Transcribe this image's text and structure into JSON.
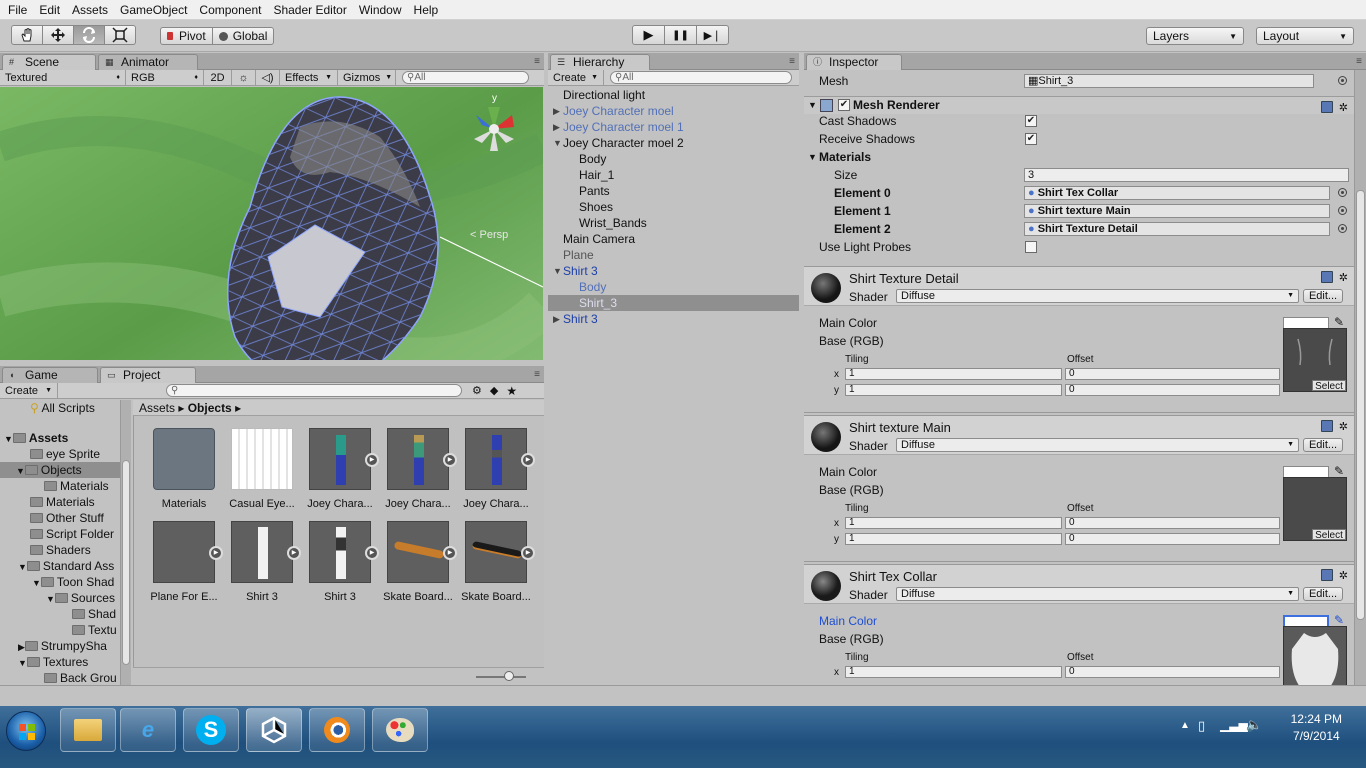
{
  "menu": [
    "File",
    "Edit",
    "Assets",
    "GameObject",
    "Component",
    "Shader Editor",
    "Window",
    "Help"
  ],
  "toolbar": {
    "pivot": "Pivot",
    "global": "Global",
    "layers": "Layers",
    "layout": "Layout",
    "play_icon": "▶",
    "pause_icon": "❚❚",
    "step_icon": "▶❘"
  },
  "scene": {
    "tab_scene": "Scene",
    "tab_animator": "Animator",
    "render_mode": "Textured",
    "color_mode": "RGB",
    "mode_2d": "2D",
    "effects": "Effects",
    "gizmos": "Gizmos",
    "search_placeholder": "All",
    "persp": "Persp",
    "gizmo_y": "y"
  },
  "hierarchy": {
    "tab": "Hierarchy",
    "create": "Create",
    "search_placeholder": "All",
    "items": [
      {
        "label": "Directional light"
      },
      {
        "label": "Joey Character moel"
      },
      {
        "label": "Joey Character moel 1"
      },
      {
        "label": "Joey Character moel 2"
      },
      {
        "label": "Body"
      },
      {
        "label": "Hair_1"
      },
      {
        "label": "Pants"
      },
      {
        "label": "Shoes"
      },
      {
        "label": "Wrist_Bands"
      },
      {
        "label": "Main Camera"
      },
      {
        "label": "Plane"
      },
      {
        "label": "Shirt 3"
      },
      {
        "label": "Body"
      },
      {
        "label": "Shirt_3"
      },
      {
        "label": "Shirt 3"
      }
    ]
  },
  "project": {
    "tab_game": "Game",
    "tab_project": "Project",
    "create": "Create",
    "crumb_root": "Assets",
    "crumb_current": "Objects",
    "tree": [
      {
        "label": "All Scripts"
      },
      {
        "label": "Assets"
      },
      {
        "label": "eye Sprite"
      },
      {
        "label": "Objects"
      },
      {
        "label": "Materials"
      },
      {
        "label": "Materials"
      },
      {
        "label": "Other Stuff"
      },
      {
        "label": "Script Folder"
      },
      {
        "label": "Shaders"
      },
      {
        "label": "Standard Ass"
      },
      {
        "label": "Toon Shad"
      },
      {
        "label": "Sources"
      },
      {
        "label": "Shad"
      },
      {
        "label": "Textu"
      },
      {
        "label": "StrumpySha"
      },
      {
        "label": "Textures"
      },
      {
        "label": "Back Grou"
      }
    ],
    "assets": [
      {
        "label": "Materials"
      },
      {
        "label": "Casual Eye..."
      },
      {
        "label": "Joey Chara..."
      },
      {
        "label": "Joey Chara..."
      },
      {
        "label": "Joey Chara..."
      },
      {
        "label": "Plane For E..."
      },
      {
        "label": "Shirt 3"
      },
      {
        "label": "Shirt 3"
      },
      {
        "label": "Skate Board..."
      },
      {
        "label": "Skate Board..."
      }
    ]
  },
  "inspector": {
    "tab": "Inspector",
    "mesh_label": "Mesh",
    "mesh_value": "Shirt_3",
    "renderer_title": "Mesh Renderer",
    "cast_shadows": "Cast Shadows",
    "receive_shadows": "Receive Shadows",
    "materials": "Materials",
    "size_label": "Size",
    "size_value": "3",
    "elements": [
      {
        "label": "Element 0",
        "value": "Shirt Tex Collar"
      },
      {
        "label": "Element 1",
        "value": "Shirt texture Main"
      },
      {
        "label": "Element 2",
        "value": "Shirt Texture Detail"
      }
    ],
    "light_probes": "Use Light Probes",
    "shader_label": "Shader",
    "edit": "Edit...",
    "main_color": "Main Color",
    "base_rgb": "Base (RGB)",
    "tiling": "Tiling",
    "offset": "Offset",
    "x": "x",
    "y": "y",
    "select": "Select",
    "mats": [
      {
        "name": "Shirt Texture Detail",
        "shader": "Diffuse",
        "tx": "1",
        "ty": "1",
        "ox": "0",
        "oy": "0"
      },
      {
        "name": "Shirt texture Main",
        "shader": "Diffuse",
        "tx": "1",
        "ty": "1",
        "ox": "0",
        "oy": "0"
      },
      {
        "name": "Shirt Tex Collar",
        "shader": "Diffuse",
        "tx": "1",
        "ox": "0"
      }
    ]
  },
  "taskbar": {
    "skype": "S",
    "time": "12:24 PM",
    "date": "7/9/2014"
  },
  "colors": {
    "prefab_blue": "#1c3fa8",
    "scene_grass": "#6cab57",
    "taskbar": "#1f4f7d"
  }
}
